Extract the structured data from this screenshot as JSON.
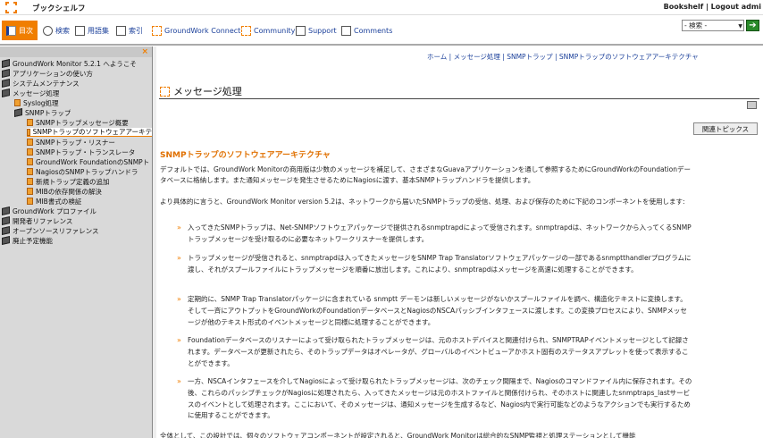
{
  "app": {
    "title": "ブックシェルフ",
    "top_links": "Bookshelf | Logout admi"
  },
  "toolbar": {
    "items": [
      "目次",
      "検索",
      "用語集",
      "索引",
      "GroundWork Connect",
      "Community",
      "Support",
      "Comments"
    ],
    "search_placeholder": "- 検索 -",
    "go": "➔"
  },
  "sidebar": {
    "close": "×",
    "items": [
      "GroundWork Monitor 5.2.1 へようこそ",
      "アプリケーションの使い方",
      "システムメンテナンス",
      "メッセージ処理",
      "Syslog処理",
      "SNMPトラップ",
      "SNMPトラップメッセージ概要",
      "SNMPトラップのソフトウェアアーキテ",
      "SNMPトラップ・リスナー",
      "SNMPトラップ・トランスレータ",
      "GroundWork FoundationのSNMPト",
      "NagiosのSNMPトラップハンドラ",
      "新規トラップ定義の追加",
      "MIBの依存関係の解決",
      "MIB書式の検証",
      "GroundWork プロファイル",
      "開発者リファレンス",
      "オープンソースリファレンス",
      "廃止予定機能"
    ]
  },
  "content": {
    "breadcrumb": "ホーム | メッセージ処理 | SNMPトラップ | SNMPトラップのソフトウェアアーキテクチャ",
    "page_title": "メッセージ処理",
    "related_topics": "関連トピックス",
    "section_title": "SNMPトラップのソフトウェアアーキテクチャ",
    "intro_1": "デフォルトでは、GroundWork Monitorの商用版は少数のメッセージを補足して、さまざまなGuavaアプリケーションを通して参照するためにGroundWorkのFoundationデータベースに格納します。また通知メッセージを発生させるためにNagiosに渡す、基本SNMPトラップハンドラを提供します。",
    "intro_2": "より具体的に言うと、GroundWork Monitor version 5.2は、ネットワークから届いたSNMPトラップの受信、処理、および保存のために下記のコンポーネントを使用します:",
    "bullets": [
      "入ってきたSNMPトラップは、Net-SNMPソフトウェアパッケージで提供されるsnmptrapdによって受信されます。snmptrapdは、ネットワークから入ってくるSNMPトラップメッセージを受け取るのに必要なネットワークリスナーを提供します。",
      "トラップメッセージが受信されると、snmptrapdは入ってきたメッセージをSNMP Trap Translatorソフトウェアパッケージの一部であるsnmptthandlerプログラムに渡し、それがスプールファイルにトラップメッセージを順番に放出します。これにより、snmptrapdはメッセージを高速に処理することができます。",
      "定期的に、SNMP Trap Translatorパッケージに含まれている snmptt デーモンは新しいメッセージがないかスプールファイルを調べ、構造化テキストに変換します。そして一斉にアウトプットをGroundWorkのFoundationデータベースとNagiosのNSCAパッシブインタフェースに渡します。この変換プロセスにより、SNMPメッセージが他のテキスト形式のイベントメッセージと同様に処理することができます。",
      "Foundationデータベースのリスナーによって受け取られたトラップメッセージは、元のホストデバイスと関連付けられ、SNMPTRAPイベントメッセージとして記録されます。データベースが更新されたら、そのトラップデータはオペレータが、グローバルのイベントビューアかホスト固有のステータスアプレットを使って表示することができます。",
      "一方、NSCAインタフェースを介してNagiosによって受け取られたトラップメッセージは、次のチェック間隔まで、Nagiosのコマンドファイル内に保存されます。その後、これらのパッシブチェックがNagiosに処理されたら、入ってきたメッセージは元のホストファイルと関係付けられ、そのホストに関連したsnmptraps_lastサービスのイベントとして処理されます。ここにおいて、そのメッセージは、通知メッセージを生成するなど、Nagios内で実行可能などのようなアクションでも実行するために使用することができます。"
    ],
    "closing": "全体として、この設計では、個々のソフトウェアコンポーネントが設定されると、GroundWork Monitorは総合的なSNMP監視と処理ステーションとして機能"
  }
}
